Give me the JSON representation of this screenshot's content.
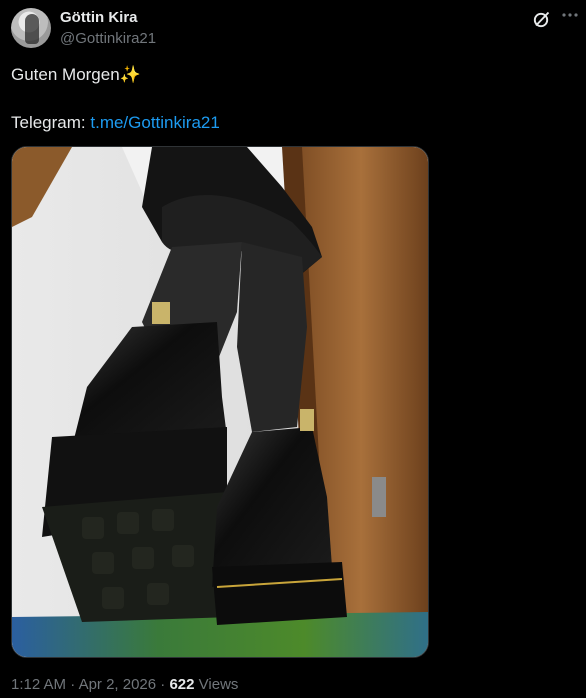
{
  "author": {
    "name": "Göttin Kira",
    "handle": "@Gottinkira21"
  },
  "icons": {
    "grok": "grok-icon",
    "more": "more-options-icon",
    "sparkles": "sparkles-emoji"
  },
  "tweet": {
    "greeting": "Guten Morgen✨",
    "telegram_label": "Telegram: ",
    "telegram_link": "t.me/Gottinkira21"
  },
  "meta": {
    "time": "1:12 AM",
    "sep1": " · ",
    "date": "Apr 2, 2026",
    "sep2": " · ",
    "views_count": "622",
    "views_label": " Views"
  },
  "colors": {
    "background": "#000000",
    "text": "#e7e9ea",
    "secondary": "#71767b",
    "link": "#1d9bf0"
  }
}
